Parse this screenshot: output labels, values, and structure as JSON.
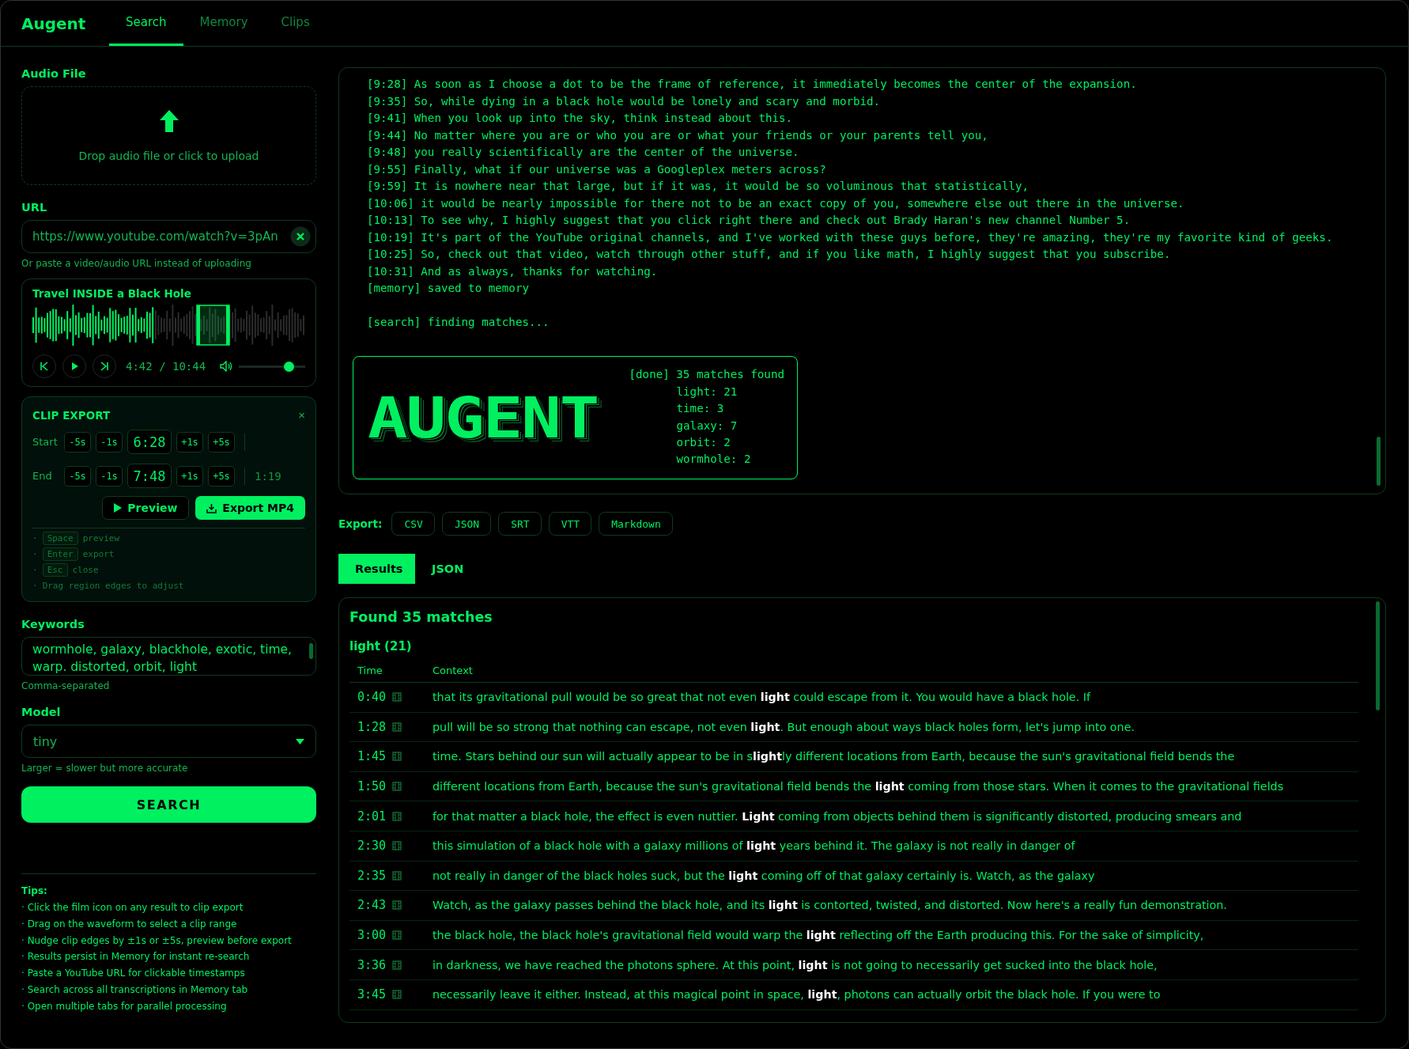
{
  "header": {
    "brand": "Augent",
    "tabs": [
      {
        "label": "Search",
        "selected": true
      },
      {
        "label": "Memory",
        "selected": false
      },
      {
        "label": "Clips",
        "selected": false
      }
    ]
  },
  "sidebar": {
    "audio_file": {
      "label": "Audio File",
      "prompt": "Drop audio file or click to upload"
    },
    "url": {
      "label": "URL",
      "value": "https://www.youtube.com/watch?v=3pAn",
      "hint": "Or paste a video/audio URL instead of uploading"
    },
    "player": {
      "title": "Travel INSIDE a Black Hole",
      "time": "4:42 / 10:44",
      "volume": {
        "level": 0.75
      }
    },
    "clip_export": {
      "title": "CLIP EXPORT",
      "close": "×",
      "rows": [
        {
          "label": "Start",
          "minus": [
            "-5s",
            "-1s"
          ],
          "value": "6:28",
          "plus": [
            "+1s",
            "+5s"
          ]
        },
        {
          "label": "End",
          "minus": [
            "-5s",
            "-1s"
          ],
          "value": "7:48",
          "plus": [
            "+1s",
            "+5s"
          ],
          "duration": "1:19"
        }
      ],
      "preview": "Preview",
      "export": "Export MP4",
      "shortcuts": [
        {
          "bullet": "·",
          "key": "Space",
          "text": "preview"
        },
        {
          "bullet": "·",
          "key": "Enter",
          "text": "export"
        },
        {
          "bullet": "·",
          "key": "Esc",
          "text": "close"
        },
        {
          "bullet": "·",
          "text": "Drag region edges to adjust"
        }
      ]
    },
    "keywords": {
      "label": "Keywords",
      "value": "wormhole, galaxy, blackhole, exotic, time, warp. distorted, orbit, light",
      "hint": "Comma-separated"
    },
    "model": {
      "label": "Model",
      "value": "tiny",
      "hint": "Larger = slower but more accurate"
    },
    "search_button": "SEARCH",
    "tips": {
      "title": "Tips:",
      "items": [
        "· Click the film icon on any result to clip export",
        "· Drag on the waveform to select a clip range",
        "· Nudge clip edges by ±1s or ±5s, preview before export",
        "· Results persist in Memory for instant re-search",
        "· Paste a YouTube URL for clickable timestamps",
        "· Search across all transcriptions in Memory tab",
        "· Open multiple tabs for parallel processing"
      ]
    }
  },
  "log": {
    "lines": [
      "[9:28] As soon as I choose a dot to be the frame of reference, it immediately becomes the center of the expansion.",
      "[9:35] So, while dying in a black hole would be lonely and scary and morbid.",
      "[9:41] When you look up into the sky, think instead about this.",
      "[9:44] No matter where you are or who you are or what your friends or your parents tell you,",
      "[9:48] you really scientifically are the center of the universe.",
      "[9:55] Finally, what if our universe was a Googleplex meters across?",
      "[9:59] It is nowhere near that large, but if it was, it would be so voluminous that statistically,",
      "[10:06] it would be nearly impossible for there not to be an exact copy of you, somewhere else out there in the universe.",
      "[10:13] To see why, I highly suggest that you click right there and check out Brady Haran's new channel Number 5.",
      "[10:19] It's part of the YouTube original channels, and I've worked with these guys before, they're amazing, they're my favorite kind of geeks.",
      "[10:25] So, check out that video, watch through other stuff, and if you like math, I highly suggest that you subscribe.",
      "[10:31] And as always, thanks for watching.",
      "[memory] saved to memory"
    ],
    "status": "[search] finding matches...",
    "done": {
      "logo": "AUGENT",
      "lines": [
        "[done] 35 matches found",
        "light: 21",
        "time: 3",
        "galaxy: 7",
        "orbit: 2",
        "wormhole: 2"
      ]
    }
  },
  "export": {
    "label": "Export:",
    "formats": [
      "CSV",
      "JSON",
      "SRT",
      "VTT",
      "Markdown"
    ]
  },
  "view_tabs": [
    {
      "label": "Results",
      "selected": true
    },
    {
      "label": "JSON",
      "selected": false
    }
  ],
  "results": {
    "heading": "Found 35 matches",
    "group": "light (21)",
    "columns": [
      "Time",
      "Context"
    ],
    "rows": [
      {
        "time": "0:40",
        "context": "that its gravitational pull would be so great that not even **light** could escape from it. You would have a black hole. If"
      },
      {
        "time": "1:28",
        "context": "pull will be so strong that nothing can escape, not even **light**. But enough about ways black holes form, let's jump into one."
      },
      {
        "time": "1:45",
        "context": "time. Stars behind our sun will actually appear to be in s**light**ly different locations from Earth, because the sun's gravitational field bends the"
      },
      {
        "time": "1:50",
        "context": "different locations from Earth, because the sun's gravitational field bends the **light** coming from those stars. When it comes to the gravitational fields"
      },
      {
        "time": "2:01",
        "context": "for that matter a black hole, the effect is even nuttier. **Light** coming from objects behind them is significantly distorted, producing smears and"
      },
      {
        "time": "2:30",
        "context": "this simulation of a black hole with a galaxy millions of **light** years behind it. The galaxy is not really in danger of"
      },
      {
        "time": "2:35",
        "context": "not really in danger of the black holes suck, but the **light** coming off of that galaxy certainly is. Watch, as the galaxy"
      },
      {
        "time": "2:43",
        "context": "Watch, as the galaxy passes behind the black hole, and its **light** is contorted, twisted, and distorted. Now here's a really fun demonstration."
      },
      {
        "time": "3:00",
        "context": "the black hole, the black hole's gravitational field would warp the **light** reflecting off the Earth producing this. For the sake of simplicity,"
      },
      {
        "time": "3:36",
        "context": "in darkness, we have reached the photons sphere. At this point, **light** is not going to necessarily get sucked into the black hole,"
      },
      {
        "time": "3:45",
        "context": "necessarily leave it either. Instead, at this magical point in space, **light**, photons can actually orbit the black hole. If you were to"
      }
    ]
  }
}
